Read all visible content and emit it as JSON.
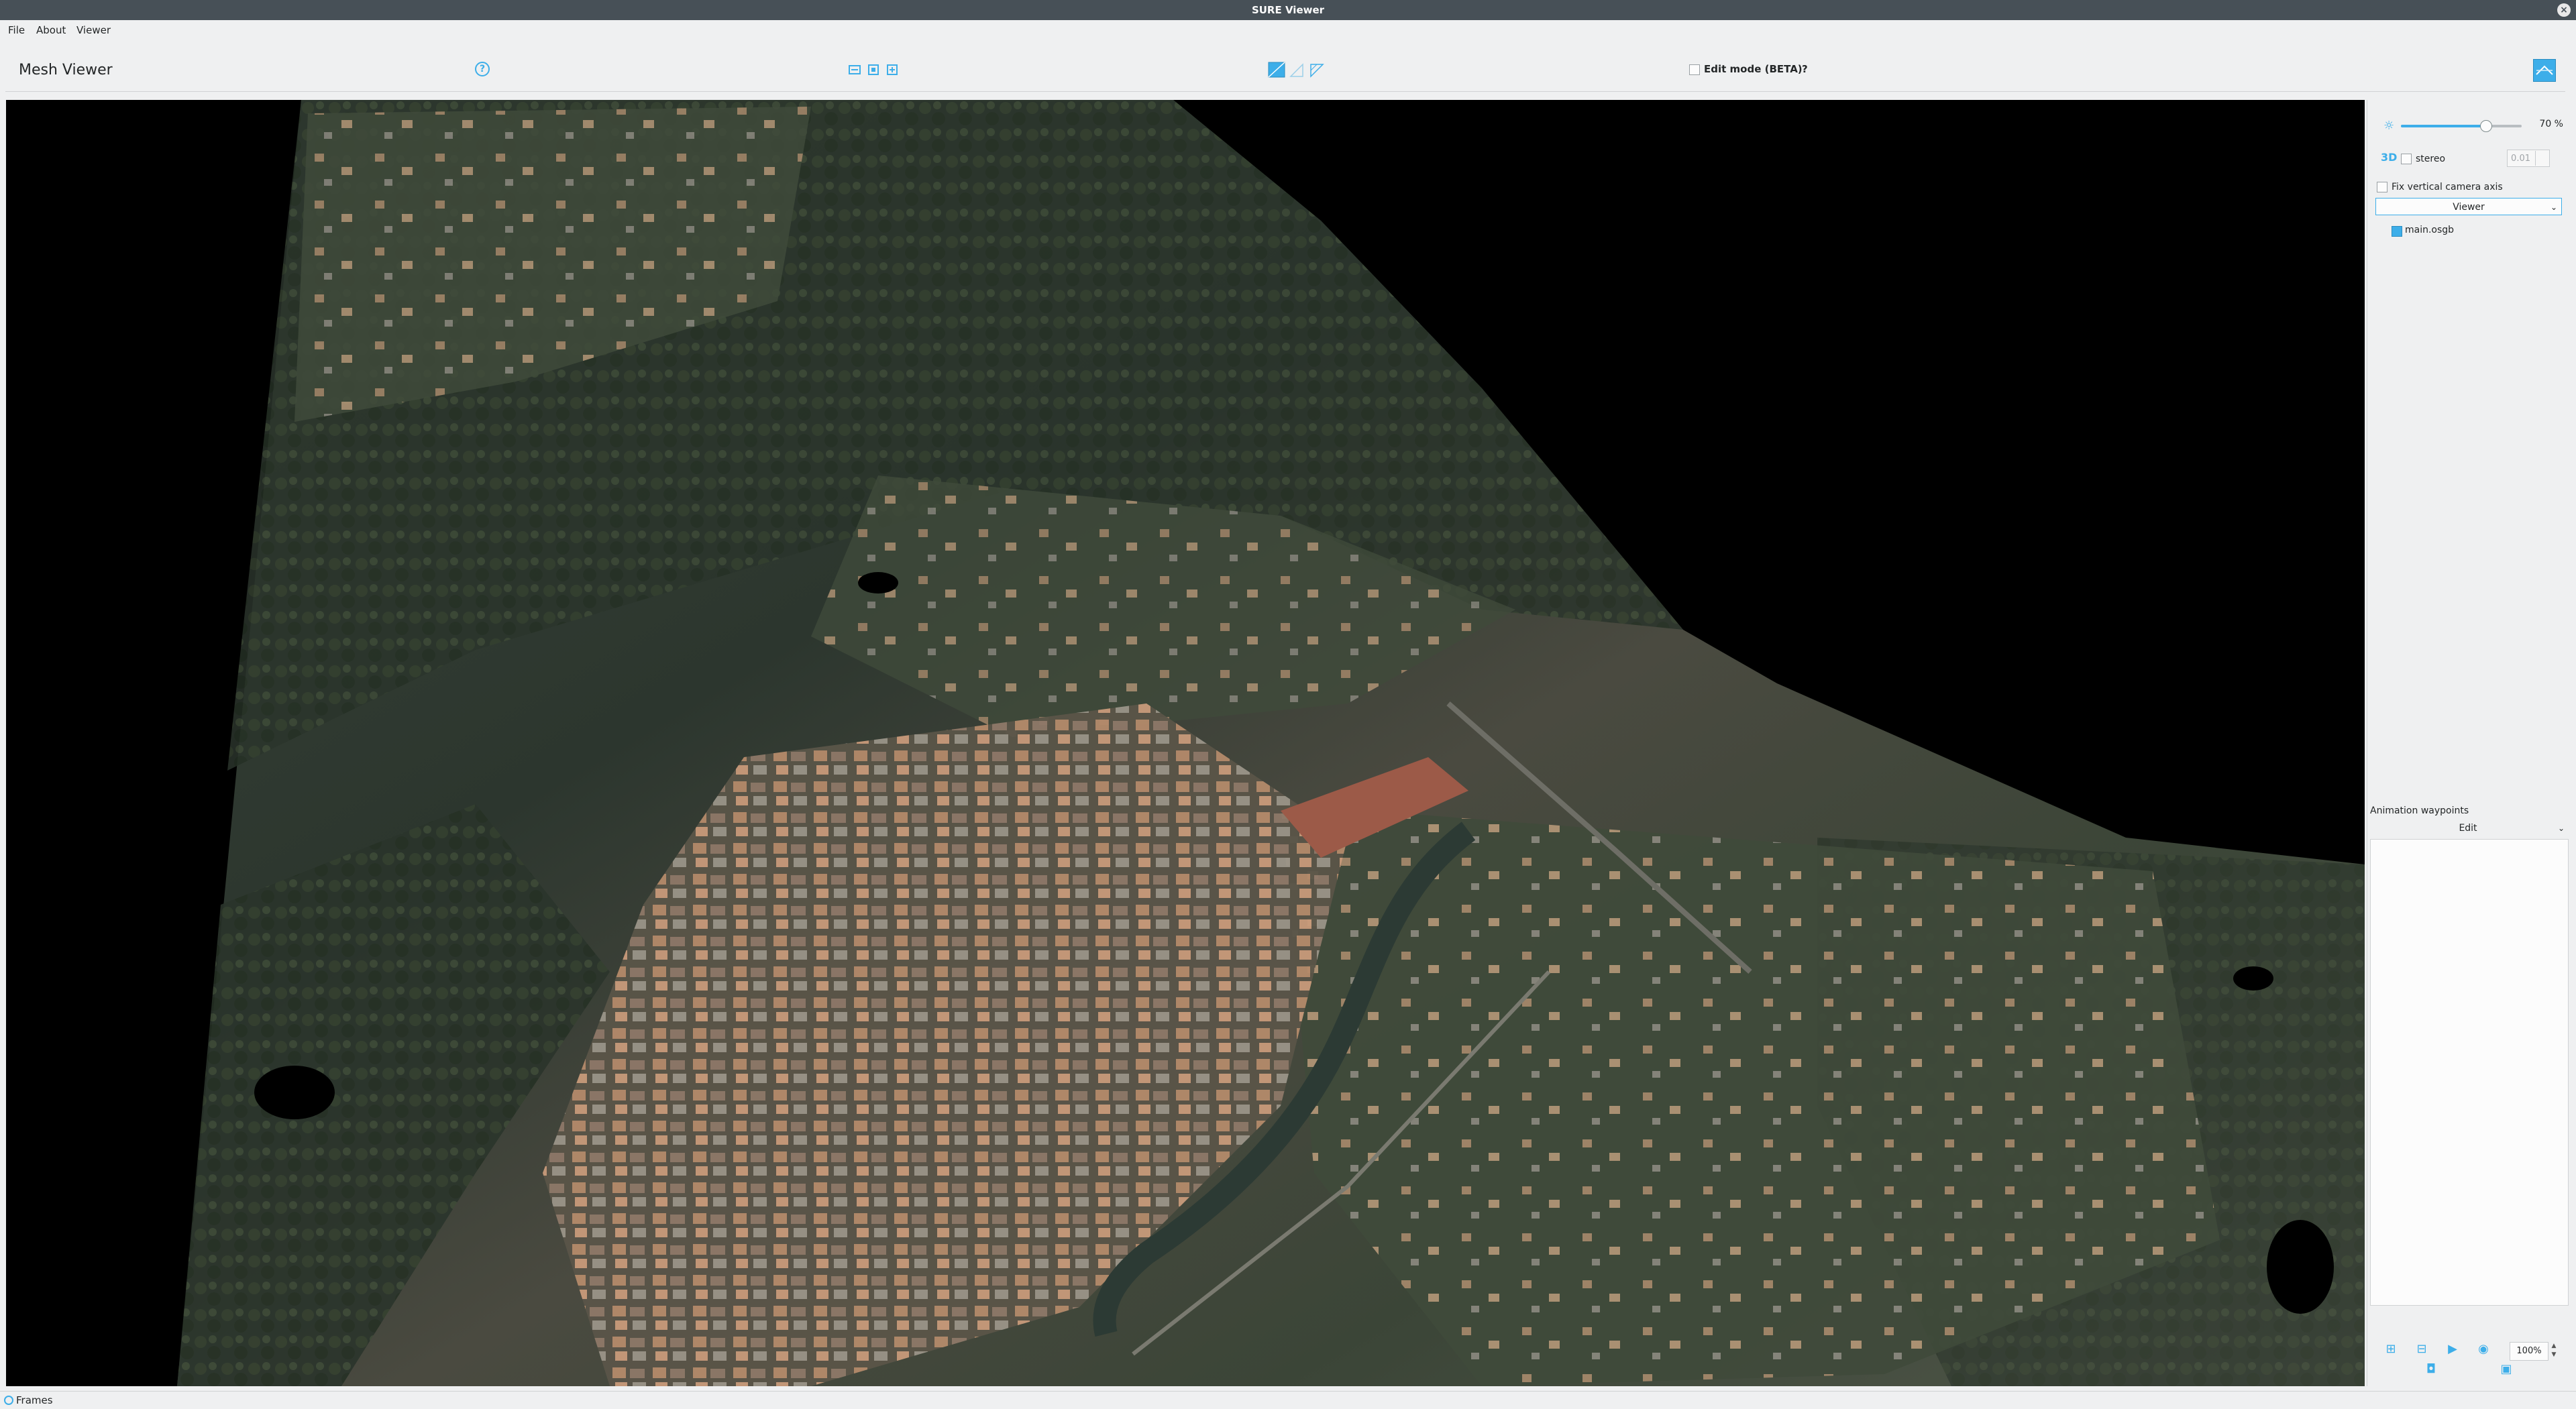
{
  "window": {
    "title": "SURE Viewer"
  },
  "menu": {
    "items": [
      "File",
      "About",
      "Viewer"
    ]
  },
  "toolbar": {
    "heading": "Mesh Viewer",
    "edit_mode_label": "Edit mode (BETA)",
    "edit_mode_help": "?"
  },
  "panel": {
    "opacity_value": "70 %",
    "opacity_fraction": 0.7,
    "badge_3d": "3D",
    "stereo_label": "stereo",
    "stereo_value": "0.01",
    "fix_vertical_label": "Fix vertical camera axis",
    "view_combo": "Viewer",
    "tree_items": [
      "main.osgb"
    ],
    "animation_title": "Animation waypoints",
    "animation_mode": "Edit",
    "zoom_value": "100%"
  },
  "statusbar": {
    "label": "Frames"
  },
  "colors": {
    "accent": "#3daee9",
    "titlebar": "#475057",
    "background": "#eff0f1"
  }
}
